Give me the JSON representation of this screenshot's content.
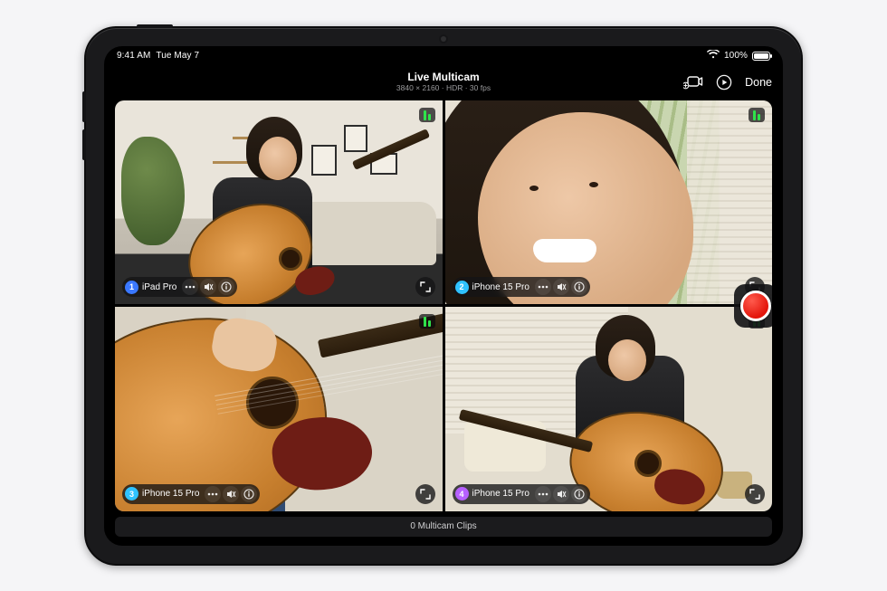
{
  "status": {
    "time": "9:41 AM",
    "date": "Tue May 7",
    "battery_pct": "100%"
  },
  "header": {
    "title": "Live Multicam",
    "subtitle": "3840 × 2160 · HDR · 30 fps",
    "done_label": "Done"
  },
  "record": {
    "recording": false
  },
  "feeds": [
    {
      "index": "1",
      "label": "iPad Pro",
      "badge_color": "#3a78ff",
      "audio_levels": [
        11,
        7
      ]
    },
    {
      "index": "2",
      "label": "iPhone 15 Pro",
      "badge_color": "#2fc2ff",
      "audio_levels": [
        11,
        7
      ]
    },
    {
      "index": "3",
      "label": "iPhone 15 Pro",
      "badge_color": "#2fc2ff",
      "audio_levels": [
        11,
        7
      ]
    },
    {
      "index": "4",
      "label": "iPhone 15 Pro",
      "badge_color": "#b760ff",
      "audio_levels": [
        11,
        7
      ]
    }
  ],
  "footer": {
    "clips_text": "0 Multicam Clips"
  }
}
